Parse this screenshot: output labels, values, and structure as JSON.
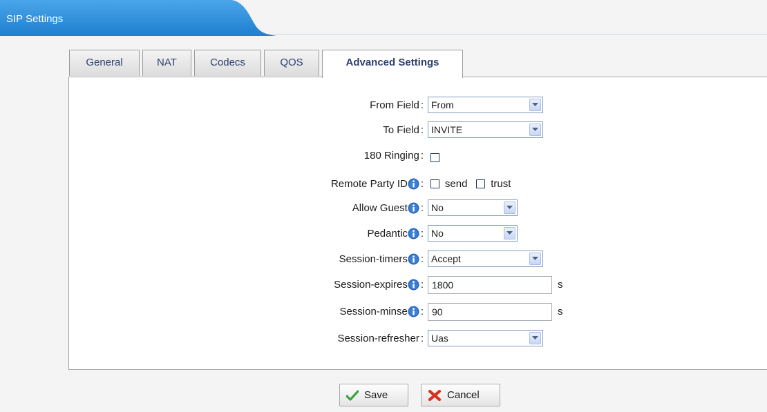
{
  "header": {
    "title": "SIP Settings"
  },
  "tabs": [
    {
      "label": "General",
      "active": false
    },
    {
      "label": "NAT",
      "active": false
    },
    {
      "label": "Codecs",
      "active": false
    },
    {
      "label": "QOS",
      "active": false
    },
    {
      "label": "Advanced Settings",
      "active": true
    }
  ],
  "form": {
    "from_field": {
      "label": "From Field",
      "value": "From"
    },
    "to_field": {
      "label": "To Field",
      "value": "INVITE"
    },
    "ringing_180": {
      "label": "180 Ringing",
      "checked": false
    },
    "remote_party_id": {
      "label": "Remote Party ID",
      "send_label": "send",
      "send_checked": false,
      "trust_label": "trust",
      "trust_checked": false
    },
    "allow_guest": {
      "label": "Allow Guest",
      "value": "No"
    },
    "pedantic": {
      "label": "Pedantic",
      "value": "No"
    },
    "session_timers": {
      "label": "Session-timers",
      "value": "Accept"
    },
    "session_expires": {
      "label": "Session-expires",
      "value": "1800",
      "unit": "s"
    },
    "session_minse": {
      "label": "Session-minse",
      "value": "90",
      "unit": "s"
    },
    "session_refresher": {
      "label": "Session-refresher",
      "value": "Uas"
    }
  },
  "buttons": {
    "save": "Save",
    "cancel": "Cancel"
  },
  "colors": {
    "header_blue": "#2d8fdc",
    "tab_text": "#2c3f6e",
    "info_icon": "#2a66b8"
  }
}
